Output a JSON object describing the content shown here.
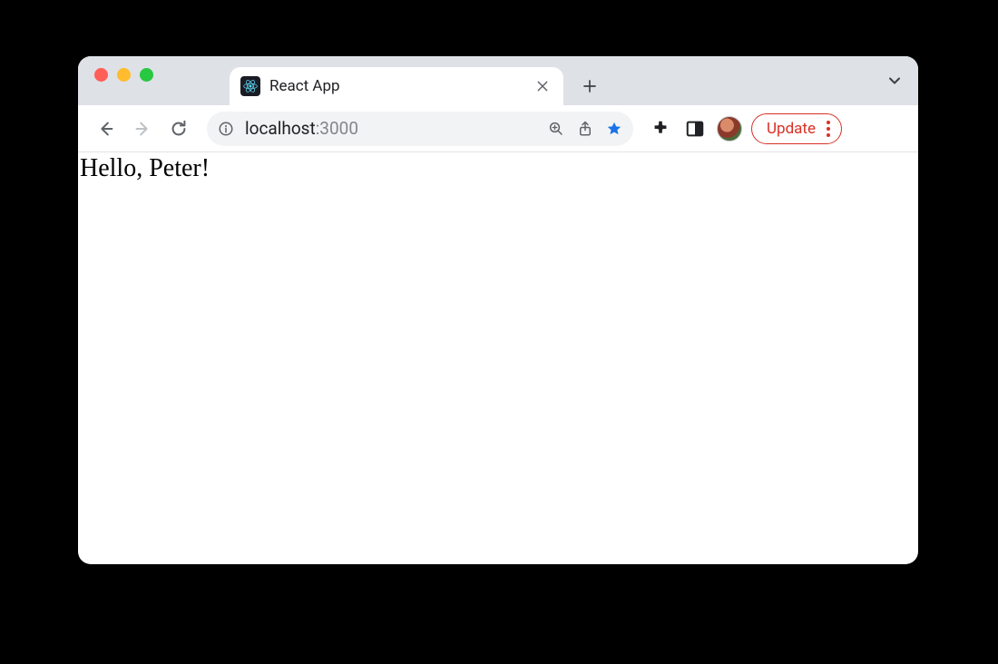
{
  "tab": {
    "title": "React App"
  },
  "addressbar": {
    "host": "localhost",
    "port_separator": ":",
    "port": "3000"
  },
  "update_button": {
    "label": "Update"
  },
  "page": {
    "greeting": "Hello, Peter!"
  }
}
